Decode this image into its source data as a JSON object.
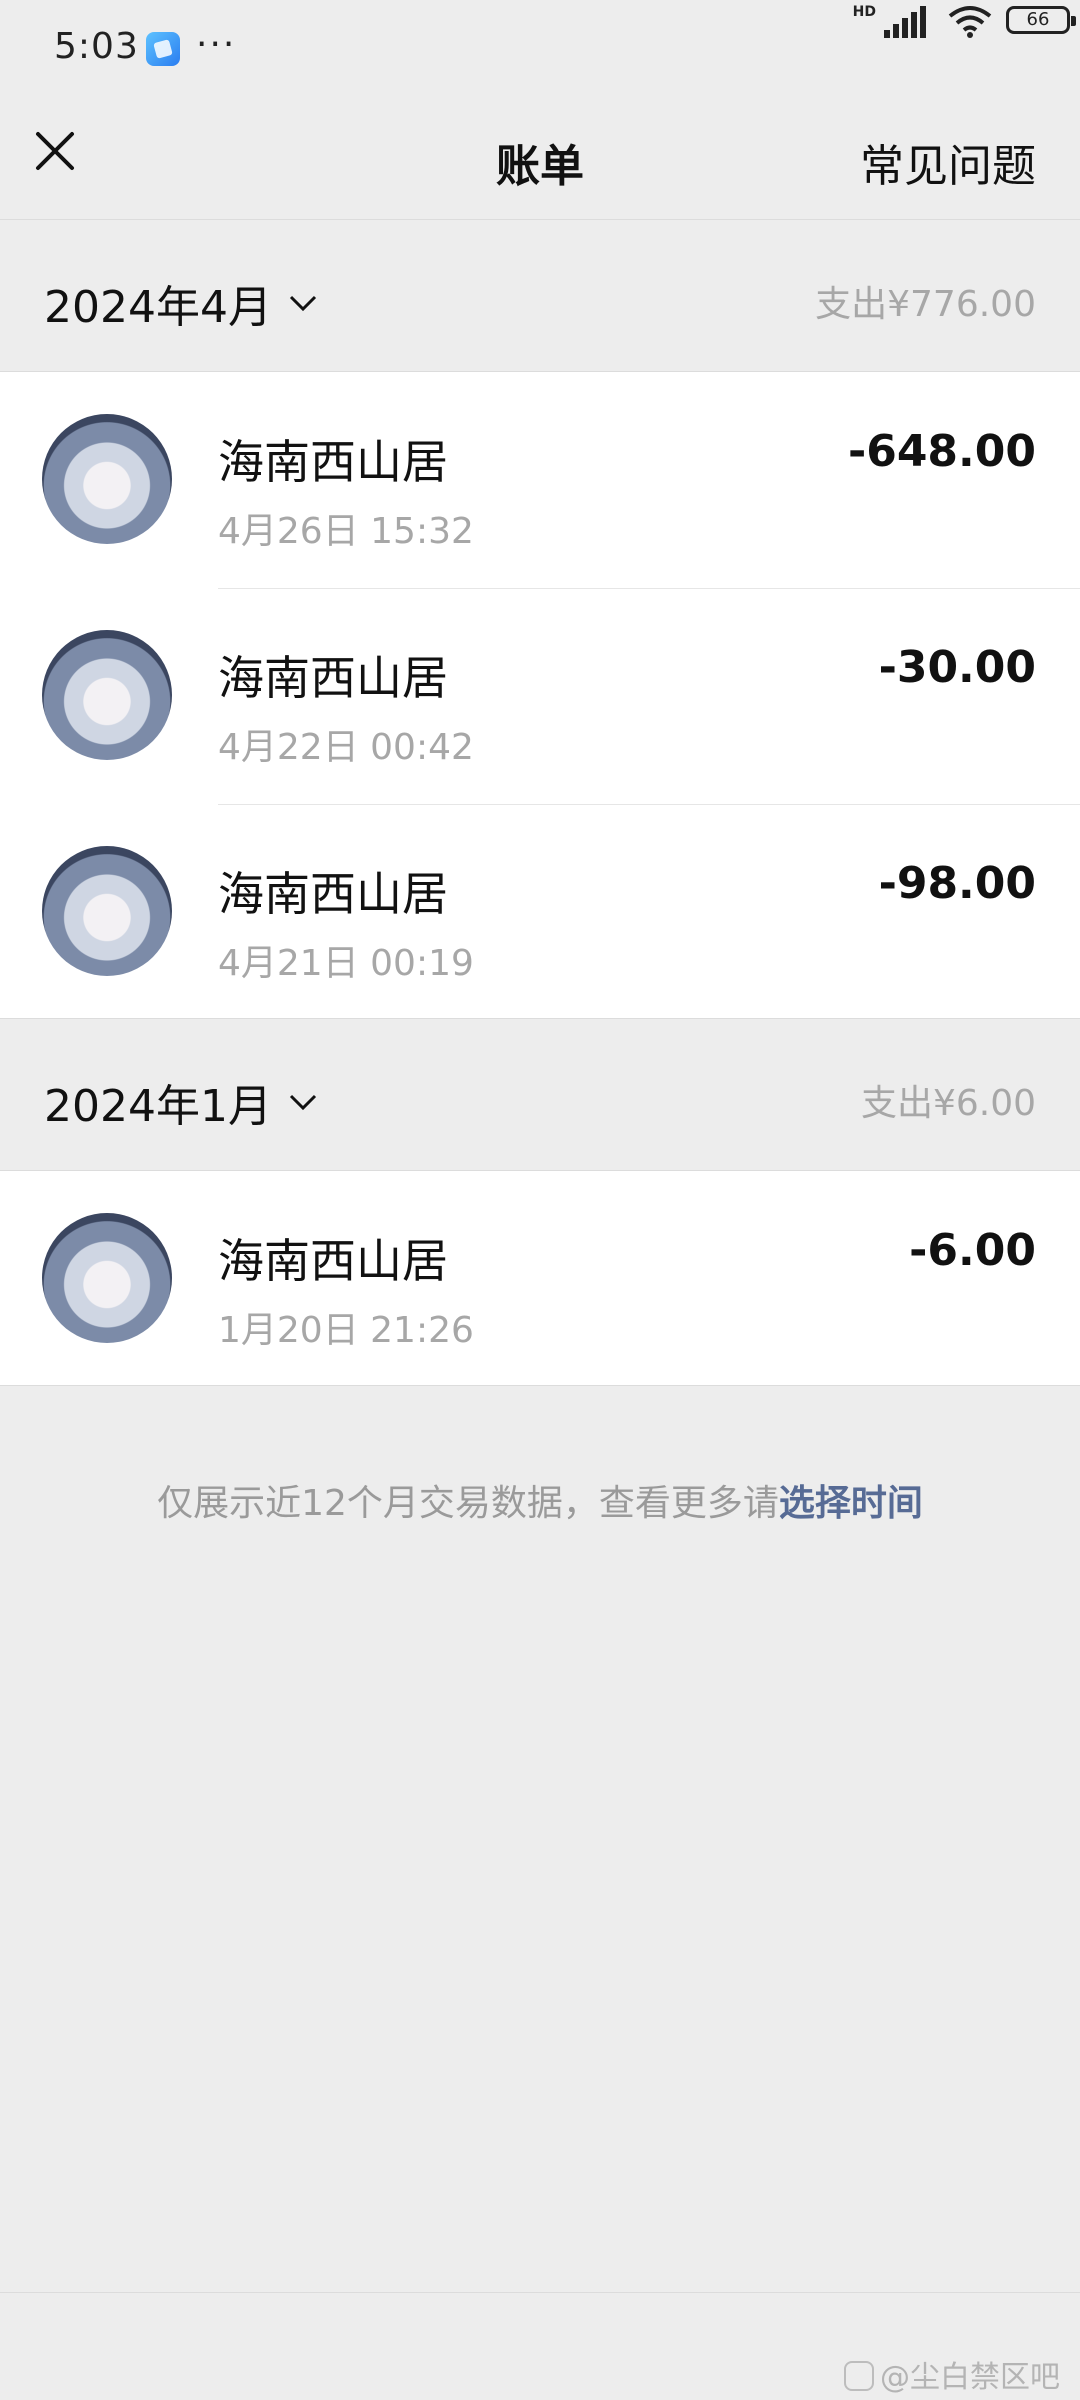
{
  "status_bar": {
    "time": "5:03",
    "dots": "···",
    "network": "HD",
    "battery": "66"
  },
  "header": {
    "title": "账单",
    "faq_label": "常见问题",
    "close_icon": "close-icon"
  },
  "sections": [
    {
      "month": "2024年4月",
      "total": "支出¥776.00",
      "transactions": [
        {
          "merchant": "海南西山居",
          "datetime": "4月26日 15:32",
          "amount": "-648.00"
        },
        {
          "merchant": "海南西山居",
          "datetime": "4月22日 00:42",
          "amount": "-30.00"
        },
        {
          "merchant": "海南西山居",
          "datetime": "4月21日 00:19",
          "amount": "-98.00"
        }
      ]
    },
    {
      "month": "2024年1月",
      "total": "支出¥6.00",
      "transactions": [
        {
          "merchant": "海南西山居",
          "datetime": "1月20日 21:26",
          "amount": "-6.00"
        }
      ]
    }
  ],
  "footer": {
    "note": "仅展示近12个月交易数据，查看更多请",
    "link": "选择时间"
  },
  "watermark": "@尘白禁区吧",
  "colors": {
    "background": "#ededed",
    "link": "#576b95",
    "secondary_text": "#a7a7a7"
  }
}
